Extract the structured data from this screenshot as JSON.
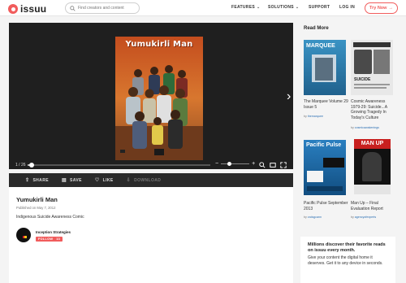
{
  "header": {
    "logo_text": "issuu",
    "search_placeholder": "Find creators and content",
    "nav": [
      {
        "label": "FEATURES",
        "has_menu": true
      },
      {
        "label": "SOLUTIONS",
        "has_menu": true
      },
      {
        "label": "SUPPORT",
        "has_menu": false
      },
      {
        "label": "LOG IN",
        "has_menu": false
      }
    ],
    "cta_label": "Try Now",
    "accent_color": "#f15c5c"
  },
  "viewer": {
    "cover_title": "Yumukirli Man",
    "page_indicator": "1 / 26",
    "progress_fraction": 0.02,
    "icons": [
      "chevron-right-icon",
      "zoom-out-icon",
      "zoom-in-icon",
      "search-icon",
      "fullscreen-icon",
      "expand-icon"
    ]
  },
  "actions": [
    {
      "label": "SHARE",
      "icon": "share-icon",
      "enabled": true
    },
    {
      "label": "SAVE",
      "icon": "bookmark-icon",
      "enabled": true
    },
    {
      "label": "LIKE",
      "icon": "heart-icon",
      "enabled": true
    },
    {
      "label": "DOWNLOAD",
      "icon": "download-icon",
      "enabled": false
    }
  ],
  "document": {
    "title": "Yumukirli Man",
    "published": "Published on May 7, 2012",
    "description": "Indigenous Suicide Awareness Comic",
    "publisher": "Inception Strategies",
    "follow_label": "FOLLOW",
    "follower_count": "13"
  },
  "sidebar": {
    "heading": "Read More",
    "cards": [
      {
        "title": "The Marquee Volume 29 Issue 5",
        "by_prefix": "by",
        "author": "themarquee",
        "thumb_text": "MARQUEE"
      },
      {
        "title": "Cosmic Awareness 1979-29: Suicide...A Growing Tragedy In Today's Culture",
        "by_prefix": "by",
        "author": "cosmicawakenings",
        "thumb_text": "SUICIDE"
      },
      {
        "title": "Pacific Pulse September 2013",
        "by_prefix": "by",
        "author": "vcdsgcann",
        "thumb_text": "Pacific Pulse"
      },
      {
        "title": "Man Up – Final Evaluation Report",
        "by_prefix": "by",
        "author": "agencyofexperts",
        "thumb_text": "MAN UP"
      }
    ],
    "promo": {
      "heading": "Millions discover their favorite reads on issuu every month.",
      "body": "Give your content the digital home it deserves. Get it to any device in seconds."
    }
  }
}
